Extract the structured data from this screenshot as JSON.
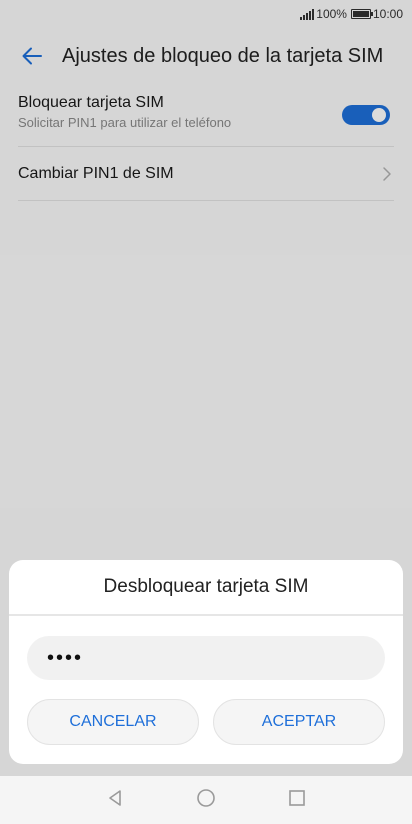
{
  "status_bar": {
    "battery": "100%",
    "time": "10:00"
  },
  "app_bar": {
    "title": "Ajustes de bloqueo de la tarjeta SIM",
    "back_icon": "arrow-left-icon"
  },
  "settings": [
    {
      "label": "Bloquear tarjeta SIM",
      "summary": "Solicitar PIN1 para utilizar el teléfono",
      "toggle_on": true
    },
    {
      "label": "Cambiar PIN1 de SIM"
    }
  ],
  "dialog": {
    "title": "Desbloquear tarjeta SIM",
    "pin_value": "••••",
    "cancel_label": "CANCELAR",
    "ok_label": "ACEPTAR"
  },
  "colors": {
    "accent": "#1e6fd9"
  },
  "nav": {
    "icons": [
      "back-triangle-icon",
      "home-circle-icon",
      "recents-square-icon"
    ]
  }
}
